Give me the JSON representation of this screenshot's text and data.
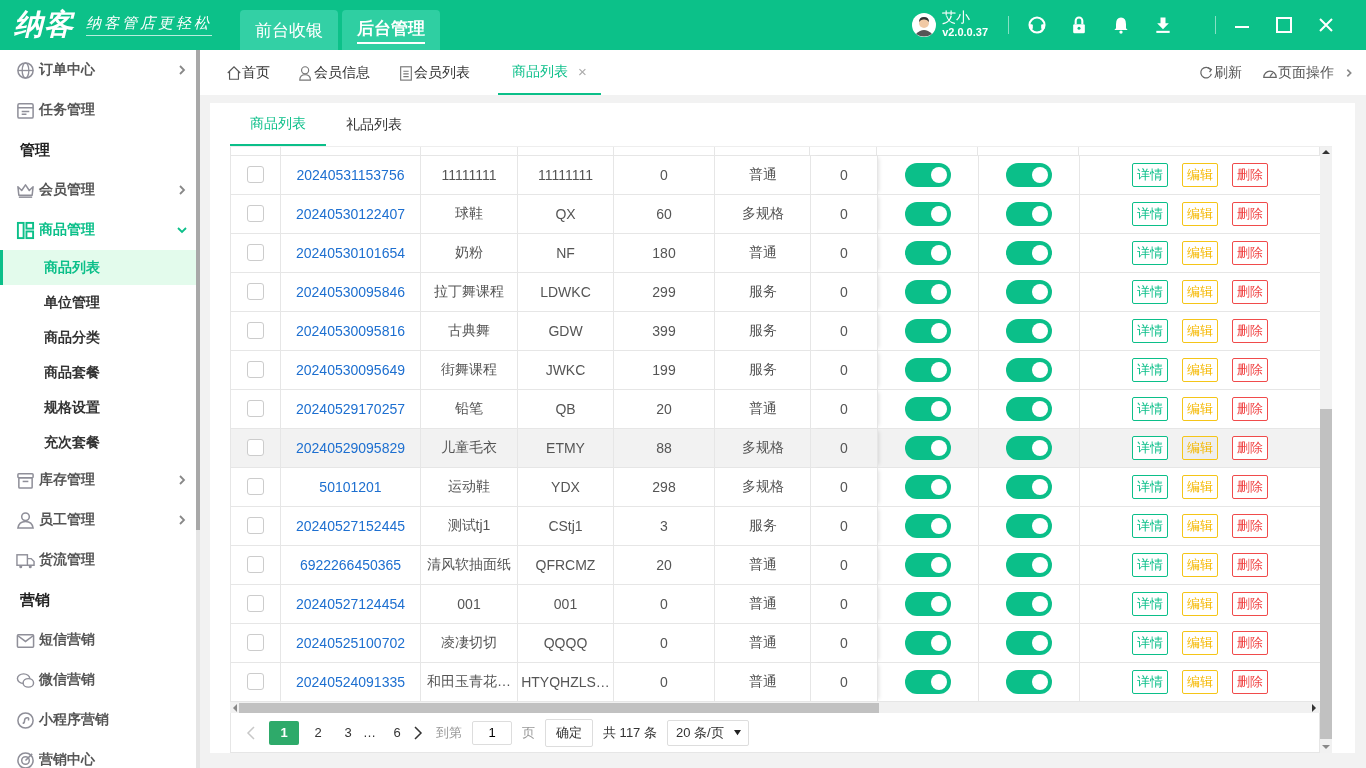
{
  "app_bar": {
    "logo": "纳客",
    "slogan": "纳客管店更轻松",
    "mode_tabs": [
      {
        "label": "前台收银",
        "selected": false
      },
      {
        "label": "后台管理",
        "selected": true
      }
    ],
    "user": {
      "name": "艾小",
      "version": "v2.0.0.37"
    }
  },
  "sidebar": {
    "items": [
      {
        "kind": "item",
        "label": "订单中心",
        "expanded": false
      },
      {
        "kind": "item",
        "label": "任务管理"
      },
      {
        "kind": "heading",
        "label": "管理"
      },
      {
        "kind": "item",
        "label": "会员管理",
        "expanded": false
      },
      {
        "kind": "item",
        "label": "商品管理",
        "expanded": true,
        "children": [
          {
            "label": "商品列表",
            "selected": true
          },
          {
            "label": "单位管理",
            "selected": false
          },
          {
            "label": "商品分类",
            "selected": false
          },
          {
            "label": "商品套餐",
            "selected": false
          },
          {
            "label": "规格设置",
            "selected": false
          },
          {
            "label": "充次套餐",
            "selected": false
          }
        ]
      },
      {
        "kind": "item",
        "label": "库存管理",
        "expanded": false
      },
      {
        "kind": "item",
        "label": "员工管理",
        "expanded": false
      },
      {
        "kind": "item",
        "label": "货流管理"
      },
      {
        "kind": "heading",
        "label": "营销"
      },
      {
        "kind": "item",
        "label": "短信营销"
      },
      {
        "kind": "item",
        "label": "微信营销"
      },
      {
        "kind": "item",
        "label": "小程序营销"
      },
      {
        "kind": "item",
        "label": "营销中心"
      }
    ]
  },
  "page_tabs": [
    {
      "label": "首页",
      "selected": false
    },
    {
      "label": "会员信息",
      "selected": false
    },
    {
      "label": "会员列表",
      "selected": false
    },
    {
      "label": "商品列表",
      "selected": true,
      "close": "×"
    }
  ],
  "page_actions": [
    "刷新",
    "页面操作"
  ],
  "sub_tabs": [
    {
      "label": "商品列表",
      "selected": true
    },
    {
      "label": "礼品列表",
      "selected": false
    }
  ],
  "table": {
    "rows": [
      {
        "selected": false,
        "checked": false,
        "cells": [
          "20240531153756",
          "11111111",
          "11111111",
          "0",
          "普通",
          "0"
        ],
        "toggle_1": true,
        "toggle_2": true,
        "actions": [
          "详情",
          "编辑",
          "删除"
        ]
      },
      {
        "selected": false,
        "checked": false,
        "cells": [
          "20240530122407",
          "球鞋",
          "QX",
          "60",
          "多规格",
          "0"
        ],
        "toggle_1": true,
        "toggle_2": true,
        "actions": [
          "详情",
          "编辑",
          "删除"
        ]
      },
      {
        "selected": false,
        "checked": false,
        "cells": [
          "20240530101654",
          "奶粉",
          "NF",
          "180",
          "普通",
          "0"
        ],
        "toggle_1": true,
        "toggle_2": true,
        "actions": [
          "详情",
          "编辑",
          "删除"
        ]
      },
      {
        "selected": false,
        "checked": false,
        "cells": [
          "20240530095846",
          "拉丁舞课程",
          "LDWKC",
          "299",
          "服务",
          "0"
        ],
        "toggle_1": true,
        "toggle_2": true,
        "actions": [
          "详情",
          "编辑",
          "删除"
        ]
      },
      {
        "selected": false,
        "checked": false,
        "cells": [
          "20240530095816",
          "古典舞",
          "GDW",
          "399",
          "服务",
          "0"
        ],
        "toggle_1": true,
        "toggle_2": true,
        "actions": [
          "详情",
          "编辑",
          "删除"
        ]
      },
      {
        "selected": false,
        "checked": false,
        "cells": [
          "20240530095649",
          "街舞课程",
          "JWKC",
          "199",
          "服务",
          "0"
        ],
        "toggle_1": true,
        "toggle_2": true,
        "actions": [
          "详情",
          "编辑",
          "删除"
        ]
      },
      {
        "selected": false,
        "checked": false,
        "cells": [
          "20240529170257",
          "铅笔",
          "QB",
          "20",
          "普通",
          "0"
        ],
        "toggle_1": true,
        "toggle_2": true,
        "actions": [
          "详情",
          "编辑",
          "删除"
        ]
      },
      {
        "selected": true,
        "checked": false,
        "cells": [
          "20240529095829",
          "儿童毛衣",
          "ETMY",
          "88",
          "多规格",
          "0"
        ],
        "toggle_1": true,
        "toggle_2": true,
        "actions": [
          "详情",
          "编辑",
          "删除"
        ]
      },
      {
        "selected": false,
        "checked": false,
        "cells": [
          "50101201",
          "运动鞋",
          "YDX",
          "298",
          "多规格",
          "0"
        ],
        "toggle_1": true,
        "toggle_2": true,
        "actions": [
          "详情",
          "编辑",
          "删除"
        ]
      },
      {
        "selected": false,
        "checked": false,
        "cells": [
          "20240527152445",
          "测试tj1",
          "CStj1",
          "3",
          "服务",
          "0"
        ],
        "toggle_1": true,
        "toggle_2": true,
        "actions": [
          "详情",
          "编辑",
          "删除"
        ]
      },
      {
        "selected": false,
        "checked": false,
        "cells": [
          "6922266450365",
          "清风软抽面纸",
          "QFRCMZ",
          "20",
          "普通",
          "0"
        ],
        "toggle_1": true,
        "toggle_2": true,
        "actions": [
          "详情",
          "编辑",
          "删除"
        ]
      },
      {
        "selected": false,
        "checked": false,
        "cells": [
          "20240527124454",
          "001",
          "001",
          "0",
          "普通",
          "0"
        ],
        "toggle_1": true,
        "toggle_2": true,
        "actions": [
          "详情",
          "编辑",
          "删除"
        ]
      },
      {
        "selected": false,
        "checked": false,
        "cells": [
          "20240525100702",
          "凌凄切切",
          "QQQQ",
          "0",
          "普通",
          "0"
        ],
        "toggle_1": true,
        "toggle_2": true,
        "actions": [
          "详情",
          "编辑",
          "删除"
        ]
      },
      {
        "selected": false,
        "checked": false,
        "cells": [
          "20240524091335",
          "和田玉青花…",
          "HTYQHZLS…",
          "0",
          "普通",
          "0"
        ],
        "toggle_1": true,
        "toggle_2": true,
        "actions": [
          "详情",
          "编辑",
          "删除"
        ]
      }
    ]
  },
  "pagination": {
    "prev_disabled": true,
    "pages": [
      {
        "kind": "page",
        "label": "1",
        "selected": true
      },
      {
        "kind": "page",
        "label": "2",
        "selected": false
      },
      {
        "kind": "page",
        "label": "3",
        "selected": false
      },
      {
        "kind": "ellipsis",
        "label": "…"
      },
      {
        "kind": "page",
        "label": "6",
        "selected": false
      }
    ],
    "goto_label": "到第",
    "goto_value": "1",
    "page_unit": "页",
    "confirm": "确定",
    "total": "共 117 条",
    "page_size": "20 条/页"
  }
}
